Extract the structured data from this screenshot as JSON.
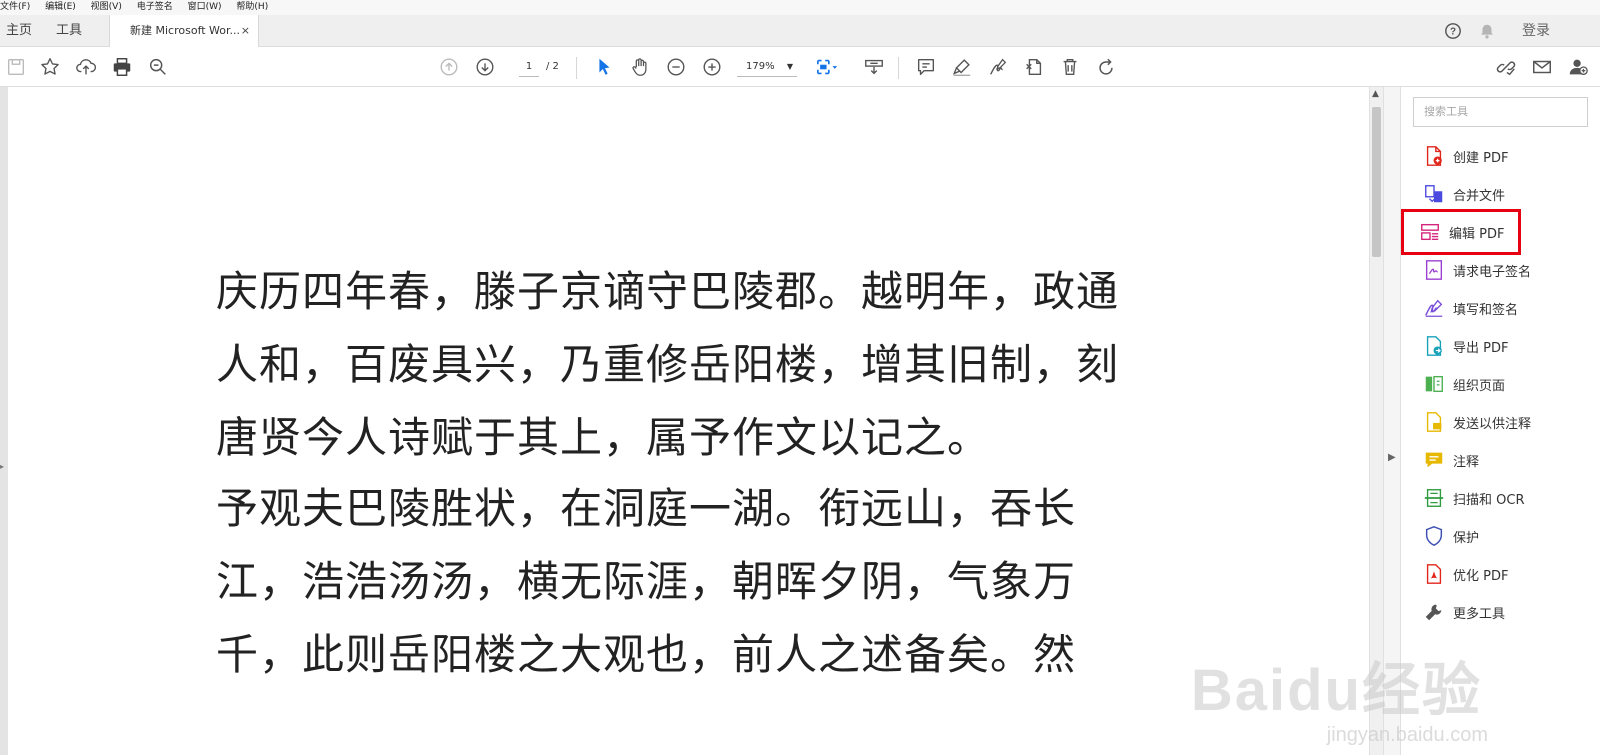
{
  "menubar": [
    "文件(F)",
    "编辑(E)",
    "视图(V)",
    "电子签名",
    "窗口(W)",
    "帮助(H)"
  ],
  "tabs": {
    "home": "主页",
    "tools": "工具",
    "document": "新建 Microsoft Wor...",
    "close": "×"
  },
  "header": {
    "login": "登录",
    "help_icon": "help-circle-icon",
    "bell_icon": "bell-icon"
  },
  "toolbar": {
    "page_current": "1",
    "page_total": "/ 2",
    "zoom": "179%"
  },
  "document": {
    "paragraphs": [
      "庆历四年春，滕子京谪守巴陵郡。越明年，政通人和，百废具兴，乃重修岳阳楼，增其旧制，刻唐贤今人诗赋于其上，属予作文以记之。",
      "予观夫巴陵胜状，在洞庭一湖。衔远山，吞长江，浩浩汤汤，横无际涯，朝晖夕阴，气象万千，此则岳阳楼之大观也，前人之述备矣。然"
    ]
  },
  "tools_panel": {
    "search_placeholder": "搜索工具",
    "items": [
      {
        "label": "创建 PDF",
        "icon": "create-pdf-icon",
        "color": "#e1251b"
      },
      {
        "label": "合并文件",
        "icon": "combine-files-icon",
        "color": "#4a4ae0"
      },
      {
        "label": "编辑 PDF",
        "icon": "edit-pdf-icon",
        "color": "#d4237a"
      },
      {
        "label": "请求电子签名",
        "icon": "request-signature-icon",
        "color": "#9a3fd1"
      },
      {
        "label": "填写和签名",
        "icon": "fill-sign-icon",
        "color": "#7a4fd9"
      },
      {
        "label": "导出 PDF",
        "icon": "export-pdf-icon",
        "color": "#17a2b8"
      },
      {
        "label": "组织页面",
        "icon": "organize-pages-icon",
        "color": "#4caf50"
      },
      {
        "label": "发送以供注释",
        "icon": "send-comment-icon",
        "color": "#e6b800"
      },
      {
        "label": "注释",
        "icon": "comment-icon",
        "color": "#e6b800"
      },
      {
        "label": "扫描和 OCR",
        "icon": "scan-ocr-icon",
        "color": "#2e9c3e"
      },
      {
        "label": "保护",
        "icon": "protect-icon",
        "color": "#3f51b5"
      },
      {
        "label": "优化 PDF",
        "icon": "optimize-pdf-icon",
        "color": "#e1251b"
      },
      {
        "label": "更多工具",
        "icon": "more-tools-icon",
        "color": "#555555"
      }
    ]
  },
  "watermark": {
    "logo": "Baidu经验",
    "url": "jingyan.baidu.com"
  }
}
